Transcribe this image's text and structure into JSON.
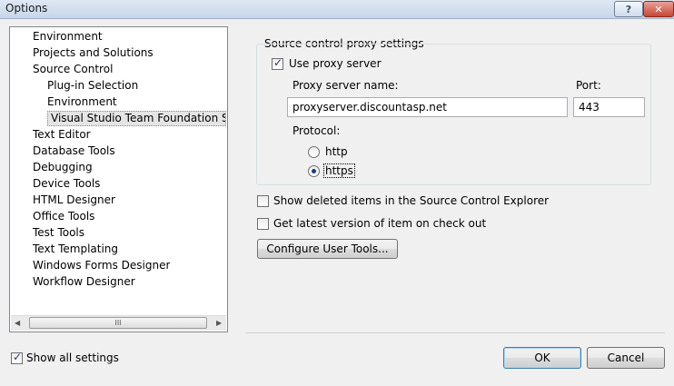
{
  "window": {
    "title": "Options"
  },
  "tree": {
    "items": [
      {
        "label": "Environment",
        "level": 0
      },
      {
        "label": "Projects and Solutions",
        "level": 0
      },
      {
        "label": "Source Control",
        "level": 0
      },
      {
        "label": "Plug-in Selection",
        "level": 1
      },
      {
        "label": "Environment",
        "level": 1
      },
      {
        "label": "Visual Studio Team Foundation Serve",
        "level": 1,
        "selected": true
      },
      {
        "label": "Text Editor",
        "level": 0
      },
      {
        "label": "Database Tools",
        "level": 0
      },
      {
        "label": "Debugging",
        "level": 0
      },
      {
        "label": "Device Tools",
        "level": 0
      },
      {
        "label": "HTML Designer",
        "level": 0
      },
      {
        "label": "Office Tools",
        "level": 0
      },
      {
        "label": "Test Tools",
        "level": 0
      },
      {
        "label": "Text Templating",
        "level": 0
      },
      {
        "label": "Windows Forms Designer",
        "level": 0
      },
      {
        "label": "Workflow Designer",
        "level": 0
      }
    ]
  },
  "proxy": {
    "group_label": "Source control proxy settings",
    "use_proxy_label": "Use proxy server",
    "use_proxy_checked": true,
    "server_name_label": "Proxy server name:",
    "server_name_value": "proxyserver.discountasp.net",
    "port_label": "Port:",
    "port_value": "443",
    "protocol_label": "Protocol:",
    "protocol_options": [
      "http",
      "https"
    ],
    "protocol_selected": "https"
  },
  "options": {
    "show_deleted_label": "Show deleted items in the Source Control Explorer",
    "show_deleted_checked": false,
    "get_latest_label": "Get latest version of item on check out",
    "get_latest_checked": false,
    "configure_tools_label": "Configure User Tools..."
  },
  "footer": {
    "show_all_label": "Show all settings",
    "show_all_checked": true,
    "ok_label": "OK",
    "cancel_label": "Cancel"
  },
  "colors": {
    "accent": "#3c7fb1",
    "close": "#c74534"
  }
}
